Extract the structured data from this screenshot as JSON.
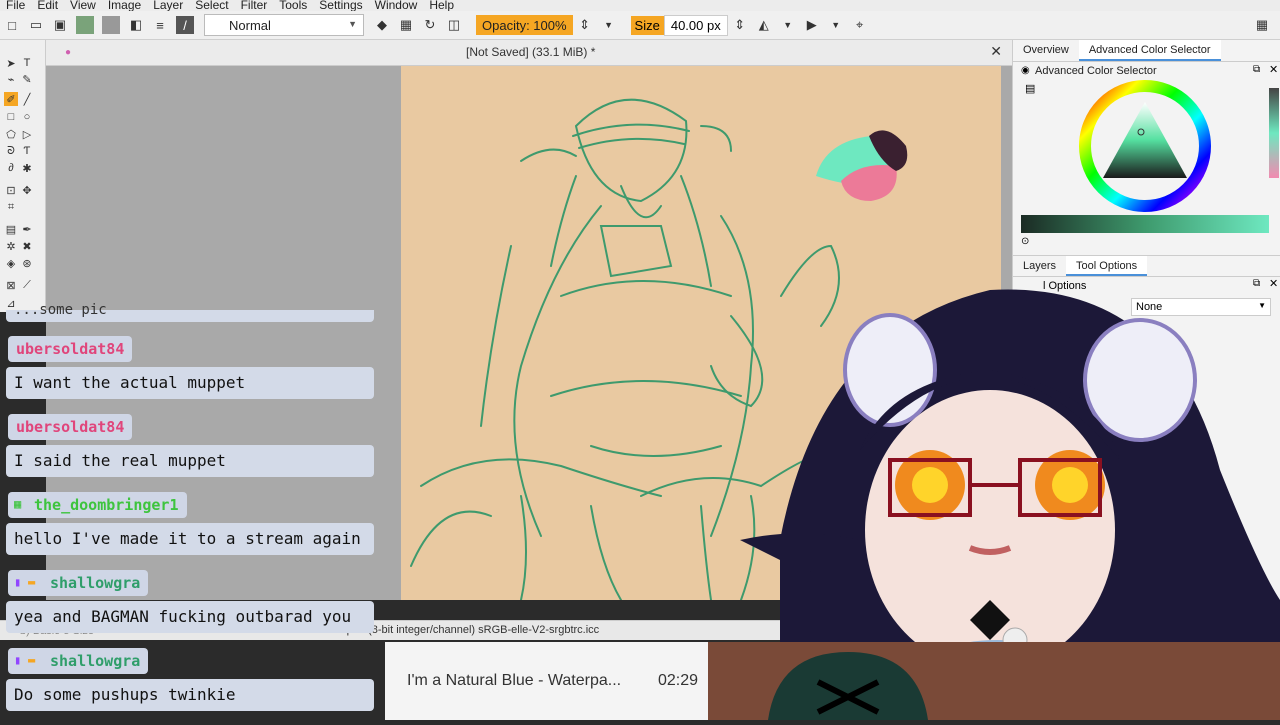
{
  "menu": [
    "File",
    "Edit",
    "View",
    "Image",
    "Layer",
    "Select",
    "Filter",
    "Tools",
    "Settings",
    "Window",
    "Help"
  ],
  "toolbar": {
    "blend_mode": "Normal",
    "opacity": "Opacity: 100%",
    "size_label": "Size",
    "size_value": "40.00 px"
  },
  "document": {
    "title": "[Not Saved]  (33.1 MiB) *"
  },
  "right_panel": {
    "tabs": [
      "Overview",
      "Advanced Color Selector"
    ],
    "header": "Advanced Color Selector",
    "tabs2": [
      "Layers",
      "Tool Options"
    ],
    "tool_options_fragment": "l Options",
    "dropdown": "None"
  },
  "status": {
    "brush": "b) Basic-5 Size",
    "color_profile": "RGB/Alpha (8-bit integer/channel)  sRGB-elle-V2-srgbtrc.icc"
  },
  "chat": [
    {
      "user": "ubersoldat84",
      "color": "#e0457b",
      "message": "I want the actual muppet"
    },
    {
      "user": "ubersoldat84",
      "color": "#e0457b",
      "message": "I said the real muppet"
    },
    {
      "user": "the_doombringer1",
      "color": "#3ec43e",
      "message": "hello I've made it to a stream again"
    },
    {
      "user": "shallowgra",
      "color": "#2f9e6a",
      "message": "yea and BAGMAN fucking outbarad you"
    },
    {
      "user": "shallowgra",
      "color": "#2f9e6a",
      "message": "Do some pushups twinkie"
    }
  ],
  "chat_top_fragment": "...some pic",
  "music": {
    "track": "I'm a Natural Blue - Waterpa...",
    "time": "02:29"
  },
  "colors": {
    "accent": "#f5a623",
    "paper": "#e9c9a1",
    "sketch": "#3e9a6d"
  }
}
